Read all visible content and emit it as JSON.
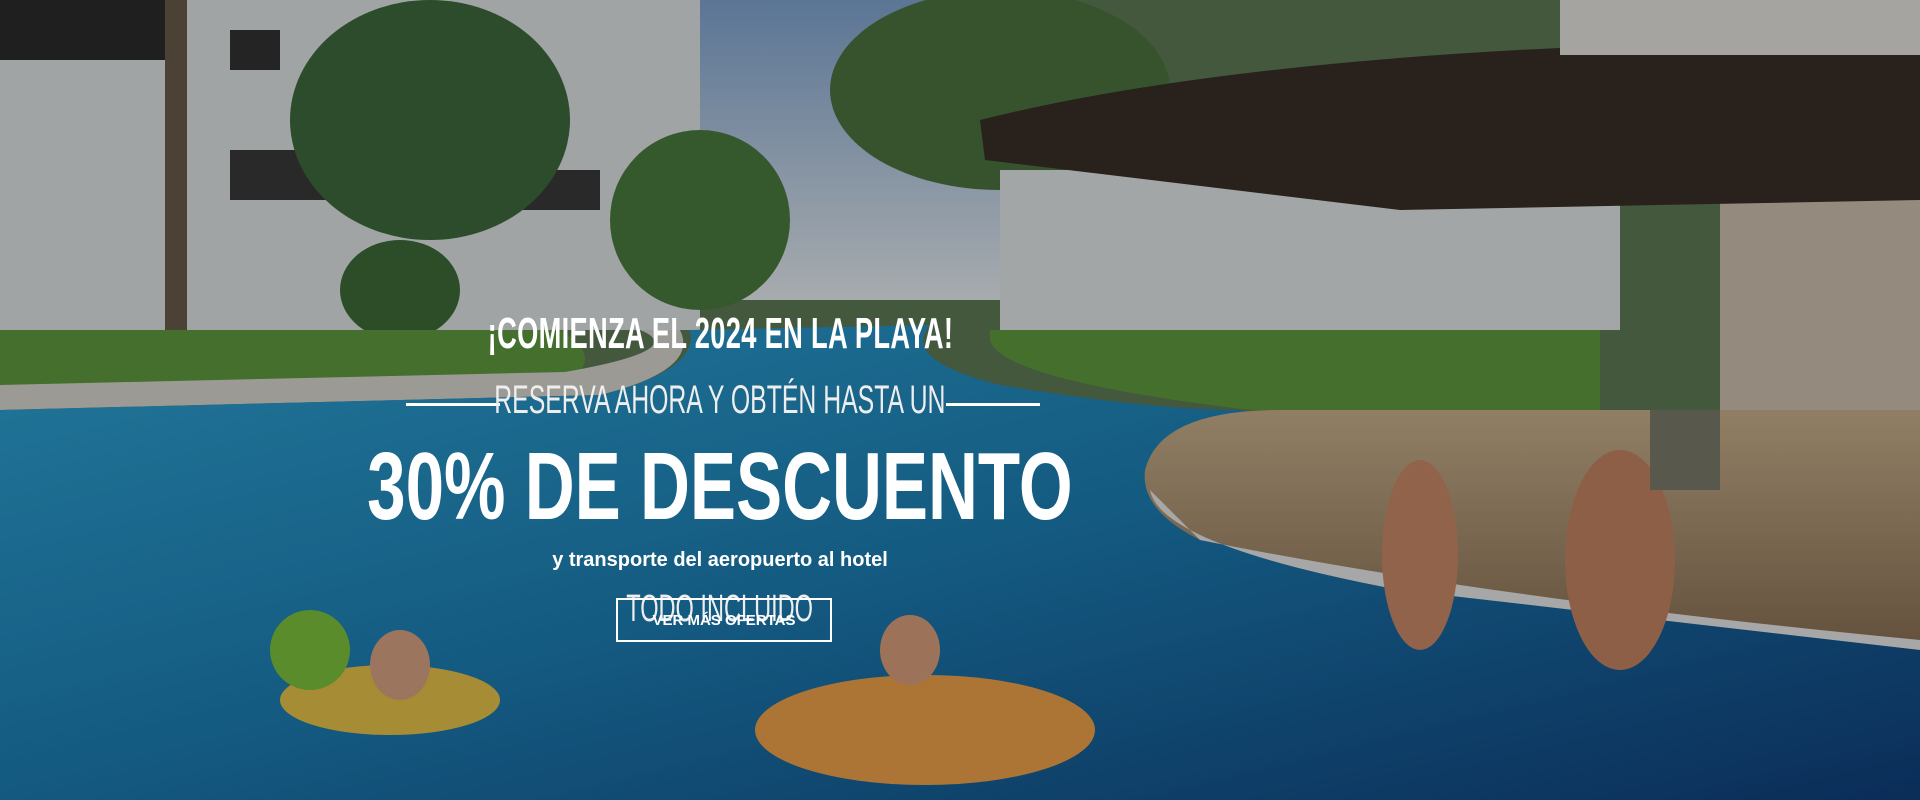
{
  "banner": {
    "headline": "¡COMIENZA EL 2024 EN LA PLAYA!",
    "subheadline": "RESERVA AHORA Y OBTÉN HASTA UN",
    "discount": "30% DE DESCUENTO",
    "extra": "y transporte del aeropuerto al hotel",
    "plan": "TODO INCLUIDO",
    "cta_label": "VER MÁS OFERTAS"
  },
  "colors": {
    "text": "#ffffff",
    "pool": "#1f7fb0",
    "overlay": "rgba(0,0,0,0.28)"
  }
}
